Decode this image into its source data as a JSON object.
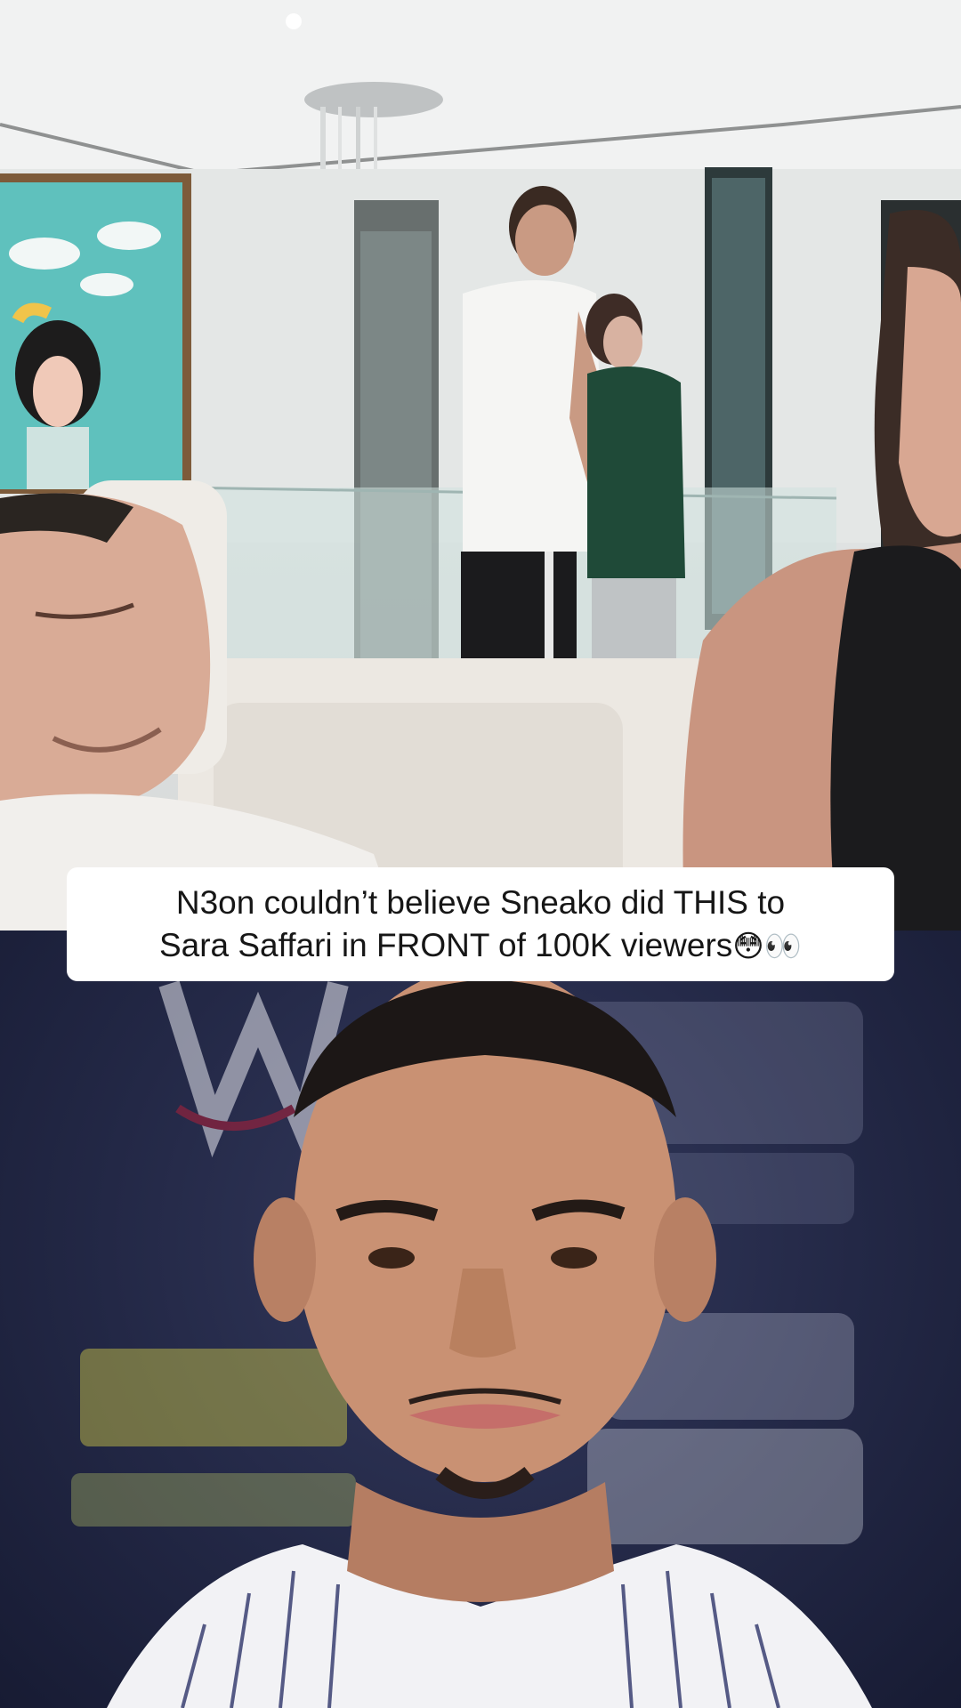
{
  "caption": {
    "line1": "N3on couldn’t believe Sneako did THIS to",
    "line2": "Sara Saffari in FRONT of 100K viewers",
    "emojis": "😳👀"
  },
  "background": {
    "top_scene": "living room stream clip",
    "bottom_scene": "press backdrop portrait",
    "bottom_backdrop_color": "#232846",
    "caption_bg": "#ffffff",
    "caption_text_color": "#161616"
  }
}
